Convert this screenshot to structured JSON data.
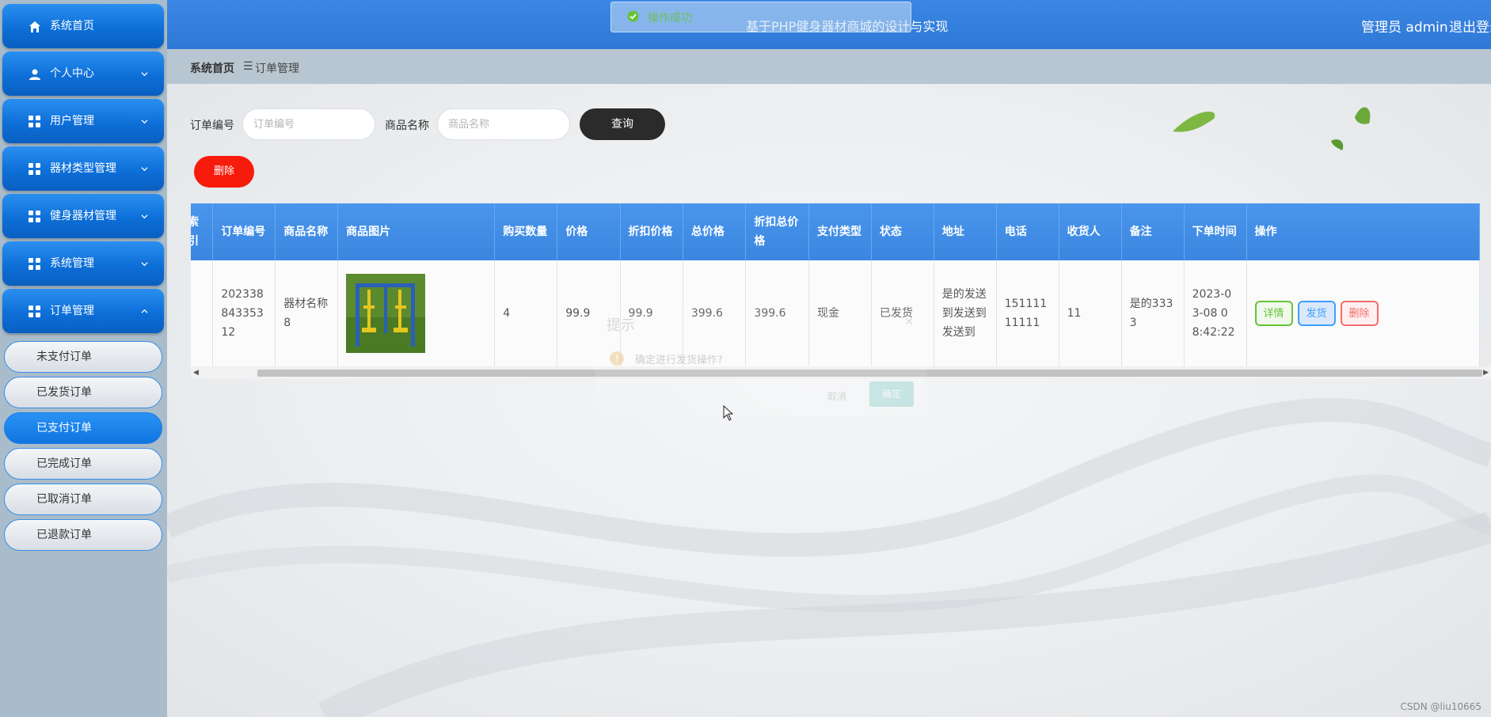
{
  "header": {
    "title": "基于PHP健身器材商城的设计与实现",
    "user": "管理员 admin",
    "logout": "退出登录"
  },
  "toast": {
    "text": "操作成功",
    "icon": "check-circle-icon",
    "color": "#67c23a"
  },
  "sidebar": {
    "items": [
      {
        "label": "系统首页",
        "icon": "home-icon"
      },
      {
        "label": "个人中心",
        "icon": "user-icon"
      },
      {
        "label": "用户管理",
        "icon": "grid-icon"
      },
      {
        "label": "器材类型管理",
        "icon": "grid-icon"
      },
      {
        "label": "健身器材管理",
        "icon": "grid-icon"
      },
      {
        "label": "系统管理",
        "icon": "grid-icon"
      },
      {
        "label": "订单管理",
        "icon": "grid-icon"
      }
    ],
    "subitems": [
      {
        "label": "未支付订单"
      },
      {
        "label": "已发货订单"
      },
      {
        "label": "已支付订单",
        "active": true
      },
      {
        "label": "已完成订单"
      },
      {
        "label": "已取消订单"
      },
      {
        "label": "已退款订单"
      }
    ]
  },
  "breadcrumb": {
    "home": "系统首页",
    "separator": "☰",
    "current": "订单管理"
  },
  "search": {
    "order_no_label": "订单编号",
    "order_no_placeholder": "订单编号",
    "product_name_label": "商品名称",
    "product_name_placeholder": "商品名称",
    "query_button": "查询"
  },
  "actions": {
    "delete_button": "删除"
  },
  "table": {
    "columns": [
      "索引",
      "订单编号",
      "商品名称",
      "商品图片",
      "购买数量",
      "价格",
      "折扣价格",
      "总价格",
      "折扣总价格",
      "支付类型",
      "状态",
      "地址",
      "电话",
      "收货人",
      "备注",
      "下单时间",
      "操作"
    ],
    "rows": [
      {
        "order_no": "20233884335312",
        "product_name": "器材名称8",
        "quantity": "4",
        "price": "99.9",
        "discount_price": "99.9",
        "total_price": "399.6",
        "discount_total": "399.6",
        "pay_type": "现金",
        "status": "已发货",
        "address": "是的发送到发送到发送到",
        "phone": "15111111111",
        "receiver": "11",
        "remark": "是的3333",
        "order_time": "2023-03-08 08:42:22",
        "ops": {
          "detail": "详情",
          "ship": "发货",
          "delete": "删除"
        }
      }
    ]
  },
  "dialog": {
    "title": "提示",
    "message": "确定进行发货操作?",
    "cancel": "取消",
    "confirm": "确定"
  },
  "watermark": "CSDN @liu10665",
  "colors": {
    "header": "#3b87e4",
    "menu": "#0d6fd8",
    "danger": "#f71b0b",
    "dark": "#2b2b2b"
  }
}
